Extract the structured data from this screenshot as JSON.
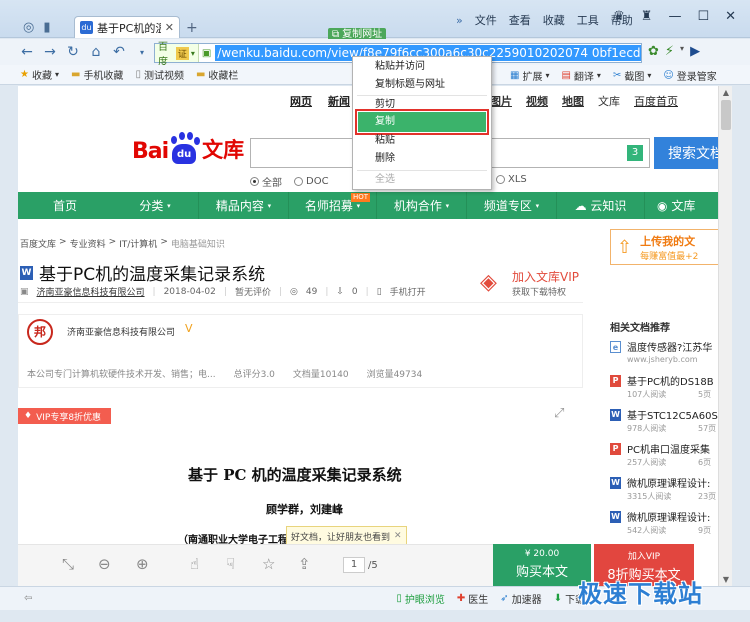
{
  "browser": {
    "tab_title": "基于PC机的温度",
    "copied_tip": "复制网址",
    "menus": [
      "文件",
      "查看",
      "收藏",
      "工具",
      "帮助"
    ],
    "address": {
      "engine": "百度",
      "cert": "证",
      "url": "/wenku.baidu.com/view/f8e79f6cc300a6c30c2259010202074 0bf1ecd11.html"
    },
    "favorites": [
      "收藏",
      "手机收藏",
      "测试视频",
      "收藏栏"
    ],
    "extensions": [
      "扩展",
      "翻译",
      "截图",
      "登录管家"
    ]
  },
  "context_menu": {
    "items": [
      "粘贴并访问",
      "复制标题与网址",
      "剪切",
      "复制",
      "粘贴",
      "删除",
      "全选"
    ],
    "highlighted": "复制"
  },
  "page": {
    "topnav": [
      "网页",
      "新闻"
    ],
    "topnav_right": [
      "图片",
      "视频",
      "地图",
      "文库",
      "百度首页"
    ],
    "logo": {
      "bai": "Bai",
      "du": "du",
      "wenku": "文库"
    },
    "search_count": "3",
    "search_button": "搜索文档",
    "radios": [
      "全部",
      "DOC"
    ],
    "radio_xls": "XLS",
    "green_nav": [
      "首页",
      "分类",
      "精品内容",
      "名师招募",
      "机构合作",
      "频道专区",
      "云知识",
      "文库"
    ],
    "hot_badge": "HOT",
    "breadcrumb": [
      "百度文库",
      "专业资料",
      "IT/计算机",
      "电脑基础知识"
    ],
    "doc_title": "基于PC机的温度采集记录系统",
    "meta": {
      "author": "济南亚豪信息科技有限公司",
      "date": "2018-04-02",
      "rating": "暂无评价",
      "views": "49",
      "downloads": "0",
      "mobile": "手机打开"
    },
    "vip": {
      "title": "加入文库VIP",
      "subtitle": "获取下载特权"
    },
    "uploader": {
      "seal": "邦",
      "name": "济南亚豪信息科技有限公司",
      "desc": "本公司专门计算机软硬件技术开发、销售；电...",
      "score": "总评分3.0",
      "docs": "文档量10140",
      "browse": "浏览量49734"
    },
    "vip_ribbon": "VIP专享8折优惠",
    "paper": {
      "title": "基于 PC 机的温度采集记录系统",
      "authors": "顾学群，刘建峰",
      "affiliation": "（南通职业大学电子工程系 江苏 南通 226007）"
    },
    "share_tip": "好文档，让好朋友也看到",
    "pager": {
      "current": "1",
      "total": "/5"
    },
    "buy": {
      "price": "¥ 20.00",
      "label": "购买本文"
    },
    "vip_buy": {
      "top": "加入VIP",
      "label": "8折购买本文"
    },
    "upload": {
      "title": "上传我的文",
      "subtitle": "每赚富值最+2"
    },
    "related_title": "相关文档推荐",
    "related": [
      {
        "icon": "e",
        "title": "温度传感器?江苏华",
        "sub": "www.jsheryb.com",
        "num": ""
      },
      {
        "icon": "p",
        "title": "基于PC机的DS18B",
        "sub": "107人阅读",
        "num": "5页"
      },
      {
        "icon": "w",
        "title": "基于STC12C5A60S",
        "sub": "978人阅读",
        "num": "57页"
      },
      {
        "icon": "p",
        "title": "PC机串口温度采集",
        "sub": "257人阅读",
        "num": "6页"
      },
      {
        "icon": "w",
        "title": "微机原理课程设计:",
        "sub": "3315人阅读",
        "num": "23页"
      },
      {
        "icon": "w",
        "title": "微机原理课程设计:",
        "sub": "542人阅读",
        "num": "9页"
      }
    ]
  },
  "statusbar": {
    "items": [
      "护眼浏览",
      "医生",
      "加速器",
      "下载"
    ]
  },
  "watermark": "极速下载站"
}
